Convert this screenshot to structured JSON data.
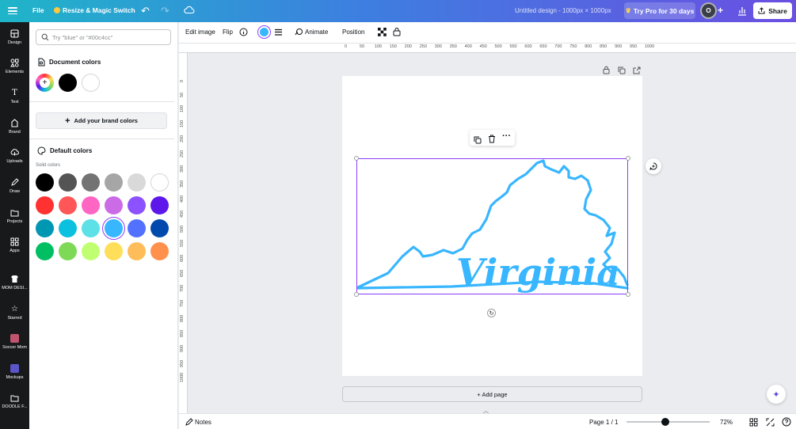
{
  "topbar": {
    "file_label": "File",
    "resize_label": "Resize & Magic Switch",
    "doc_title": "Untitled design - 1000px × 1000px",
    "pro_label": "Try Pro for 30 days",
    "avatar_initial": "O",
    "share_label": "Share"
  },
  "rail": {
    "items": [
      {
        "label": "Design",
        "icon": "design-icon"
      },
      {
        "label": "Elements",
        "icon": "elements-icon"
      },
      {
        "label": "Text",
        "icon": "text-icon"
      },
      {
        "label": "Brand",
        "icon": "brand-icon"
      },
      {
        "label": "Uploads",
        "icon": "uploads-icon"
      },
      {
        "label": "Draw",
        "icon": "draw-icon"
      },
      {
        "label": "Projects",
        "icon": "projects-icon"
      },
      {
        "label": "Apps",
        "icon": "apps-icon"
      },
      {
        "label": "MOM DESI...",
        "icon": "app-thumbnail"
      },
      {
        "label": "Starred",
        "icon": "star-icon"
      },
      {
        "label": "Soccer Mom",
        "icon": "app-thumbnail"
      },
      {
        "label": "Mockups",
        "icon": "app-thumbnail"
      },
      {
        "label": "DOODLE F...",
        "icon": "folder-icon"
      }
    ]
  },
  "panel": {
    "search_placeholder": "Try \"blue\" or \"#00c4cc\"",
    "document_colors_title": "Document colors",
    "document_colors": [
      "#000000",
      "#ffffff"
    ],
    "brand_button_label": "Add your brand colors",
    "default_colors_title": "Default colors",
    "solid_colors_label": "Solid colors",
    "solid_colors": [
      "#000000",
      "#545454",
      "#737373",
      "#a6a6a6",
      "#d9d9d9",
      "#ffffff",
      "#ff3131",
      "#ff5757",
      "#ff66c4",
      "#cb6ce6",
      "#8c52ff",
      "#5e17eb",
      "#0097b2",
      "#0cc0df",
      "#5ce1e6",
      "#38b6ff",
      "#5271ff",
      "#004aad",
      "#00bf63",
      "#7ed957",
      "#c1ff72",
      "#ffde59",
      "#ffbd59",
      "#ff914d"
    ],
    "selected_color": "#38b6ff"
  },
  "ctxbar": {
    "edit_image_label": "Edit image",
    "flip_label": "Flip",
    "current_color": "#38b6ff",
    "animate_label": "Animate",
    "position_label": "Position"
  },
  "ruler": {
    "top_ticks": [
      "0",
      "50",
      "100",
      "150",
      "200",
      "250",
      "300",
      "350",
      "400",
      "450",
      "500",
      "550",
      "600",
      "650",
      "700",
      "750",
      "800",
      "850",
      "900",
      "950",
      "1000"
    ],
    "left_ticks": [
      "0",
      "50",
      "100",
      "150",
      "200",
      "250",
      "300",
      "350",
      "400",
      "450",
      "500",
      "550",
      "600",
      "650",
      "700",
      "750",
      "800",
      "850",
      "900",
      "950",
      "1000"
    ]
  },
  "canvas": {
    "artwork_text": "Virginia",
    "artwork_color": "#38b6ff",
    "add_page_label": "+ Add page"
  },
  "bottombar": {
    "notes_label": "Notes",
    "page_indicator": "Page 1 / 1",
    "zoom_level": "72%",
    "zoom_fraction": 0.47
  }
}
